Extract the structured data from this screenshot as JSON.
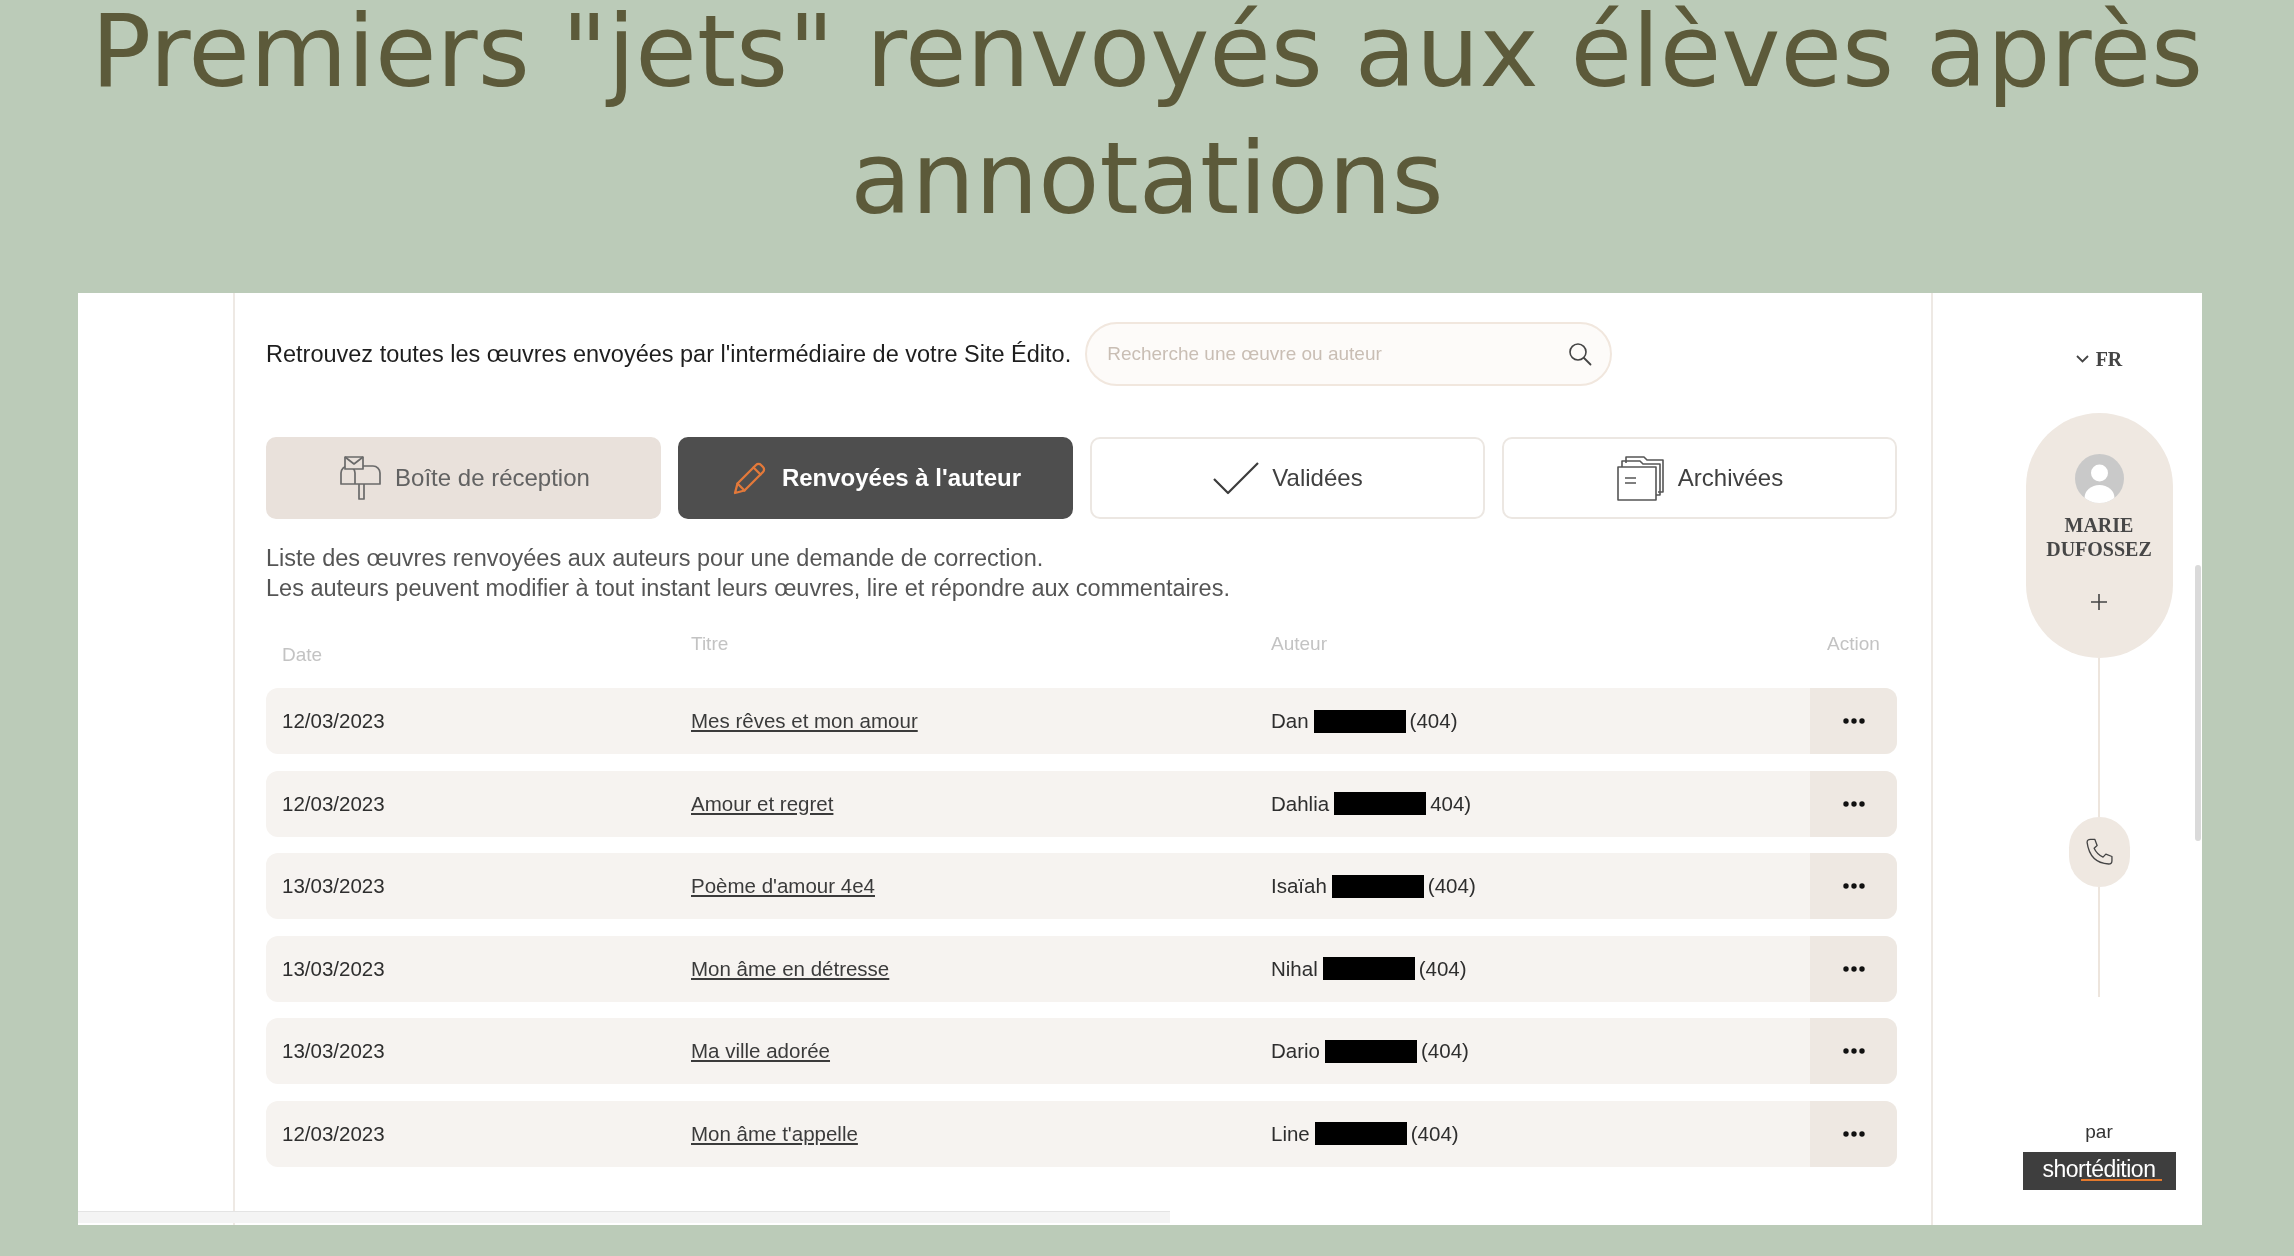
{
  "title": "Premiers \"jets\" renvoyés aux élèves après annotations",
  "screenshot": {
    "intro": "Retrouvez toutes les œuvres envoyées par l'intermédiaire de votre Site Édito.",
    "search": {
      "placeholder": "Recherche une œuvre ou auteur"
    },
    "tabs": [
      {
        "label": "Boîte de réception",
        "kind": "inbox",
        "selected": false,
        "highlighted": true
      },
      {
        "label": "Renvoyées à l'auteur",
        "kind": "returned",
        "selected": true,
        "highlighted": false
      },
      {
        "label": "Validées",
        "kind": "validated",
        "selected": false,
        "highlighted": false
      },
      {
        "label": "Archivées",
        "kind": "archived",
        "selected": false,
        "highlighted": false
      }
    ],
    "description": [
      "Liste des œuvres renvoyées aux auteurs pour une demande de correction.",
      "Les auteurs peuvent modifier à tout instant leurs œuvres, lire et répondre aux commentaires."
    ],
    "table": {
      "columns": [
        "Date",
        "Titre",
        "Auteur",
        "Action"
      ],
      "rows": [
        {
          "date": "12/03/2023",
          "title": "Mes rêves et mon amour",
          "author": {
            "name": "Dan",
            "redacted": true,
            "suffix": "(404)"
          }
        },
        {
          "date": "12/03/2023",
          "title": "Amour et regret",
          "author": {
            "name": "Dahlia",
            "redacted": true,
            "suffix": "404)"
          }
        },
        {
          "date": "13/03/2023",
          "title": "Poème d'amour 4e4",
          "author": {
            "name": "Isaïah",
            "redacted": true,
            "suffix": "(404)"
          }
        },
        {
          "date": "13/03/2023",
          "title": "Mon âme en détresse",
          "author": {
            "name": "Nihal",
            "redacted": true,
            "suffix": "(404)"
          }
        },
        {
          "date": "13/03/2023",
          "title": "Ma ville adorée",
          "author": {
            "name": "Dario",
            "redacted": true,
            "suffix": "(404)"
          }
        },
        {
          "date": "12/03/2023",
          "title": "Mon âme t'appelle",
          "author": {
            "name": "Line",
            "redacted": true,
            "suffix": "(404)"
          }
        }
      ]
    },
    "sidebar": {
      "language": "FR",
      "user": {
        "name": "MARIE DUFOSSEZ"
      },
      "credit": "par",
      "logo": "shortédition"
    }
  }
}
